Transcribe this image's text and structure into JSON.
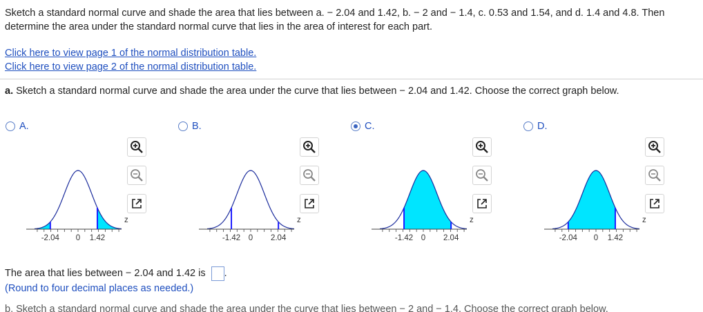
{
  "question": {
    "text": "Sketch a standard normal curve and shade the area that lies between a. − 2.04 and 1.42, b. − 2 and − 1.4, c. 0.53 and 1.54, and d. 1.4 and 4.8. Then determine the area under the standard normal curve that lies in the area of interest for each part."
  },
  "links": {
    "page1": "Click here to view page 1 of the normal distribution table.",
    "page2": "Click here to view page 2 of the normal distribution table."
  },
  "part_a": {
    "prompt_bold": "a.",
    "prompt": "Sketch a standard normal curve and shade the area under the curve that lies between − 2.04 and 1.42. Choose the correct graph below."
  },
  "options": [
    {
      "letter": "A.",
      "selected": false,
      "ticks": [
        "-2.04",
        "0",
        "1.42"
      ],
      "shade": "tails",
      "bounds": [
        -2.04,
        1.42
      ]
    },
    {
      "letter": "B.",
      "selected": false,
      "ticks": [
        "-1.42",
        "0",
        "2.04"
      ],
      "shade": "none",
      "bounds": [
        -1.42,
        2.04
      ]
    },
    {
      "letter": "C.",
      "selected": true,
      "ticks": [
        "-1.42",
        "0",
        "2.04"
      ],
      "shade": "between",
      "bounds": [
        -1.42,
        2.04
      ]
    },
    {
      "letter": "D.",
      "selected": false,
      "ticks": [
        "-2.04",
        "0",
        "1.42"
      ],
      "shade": "between",
      "bounds": [
        -2.04,
        1.42
      ]
    }
  ],
  "axis_label": "z",
  "answer": {
    "prefix": "The area that lies between − 2.04 and 1.42 is",
    "suffix": ".",
    "value": "",
    "hint": "(Round to four decimal places as needed.)"
  },
  "next_part": "b. Sketch a standard normal curve and shade the area under the curve that lies between − 2 and − 1.4. Choose the correct graph below.",
  "colors": {
    "fill": "#00e5ff",
    "curve": "#1a2b9c",
    "marker": "#1a1aff",
    "link": "#1f4fbf"
  }
}
